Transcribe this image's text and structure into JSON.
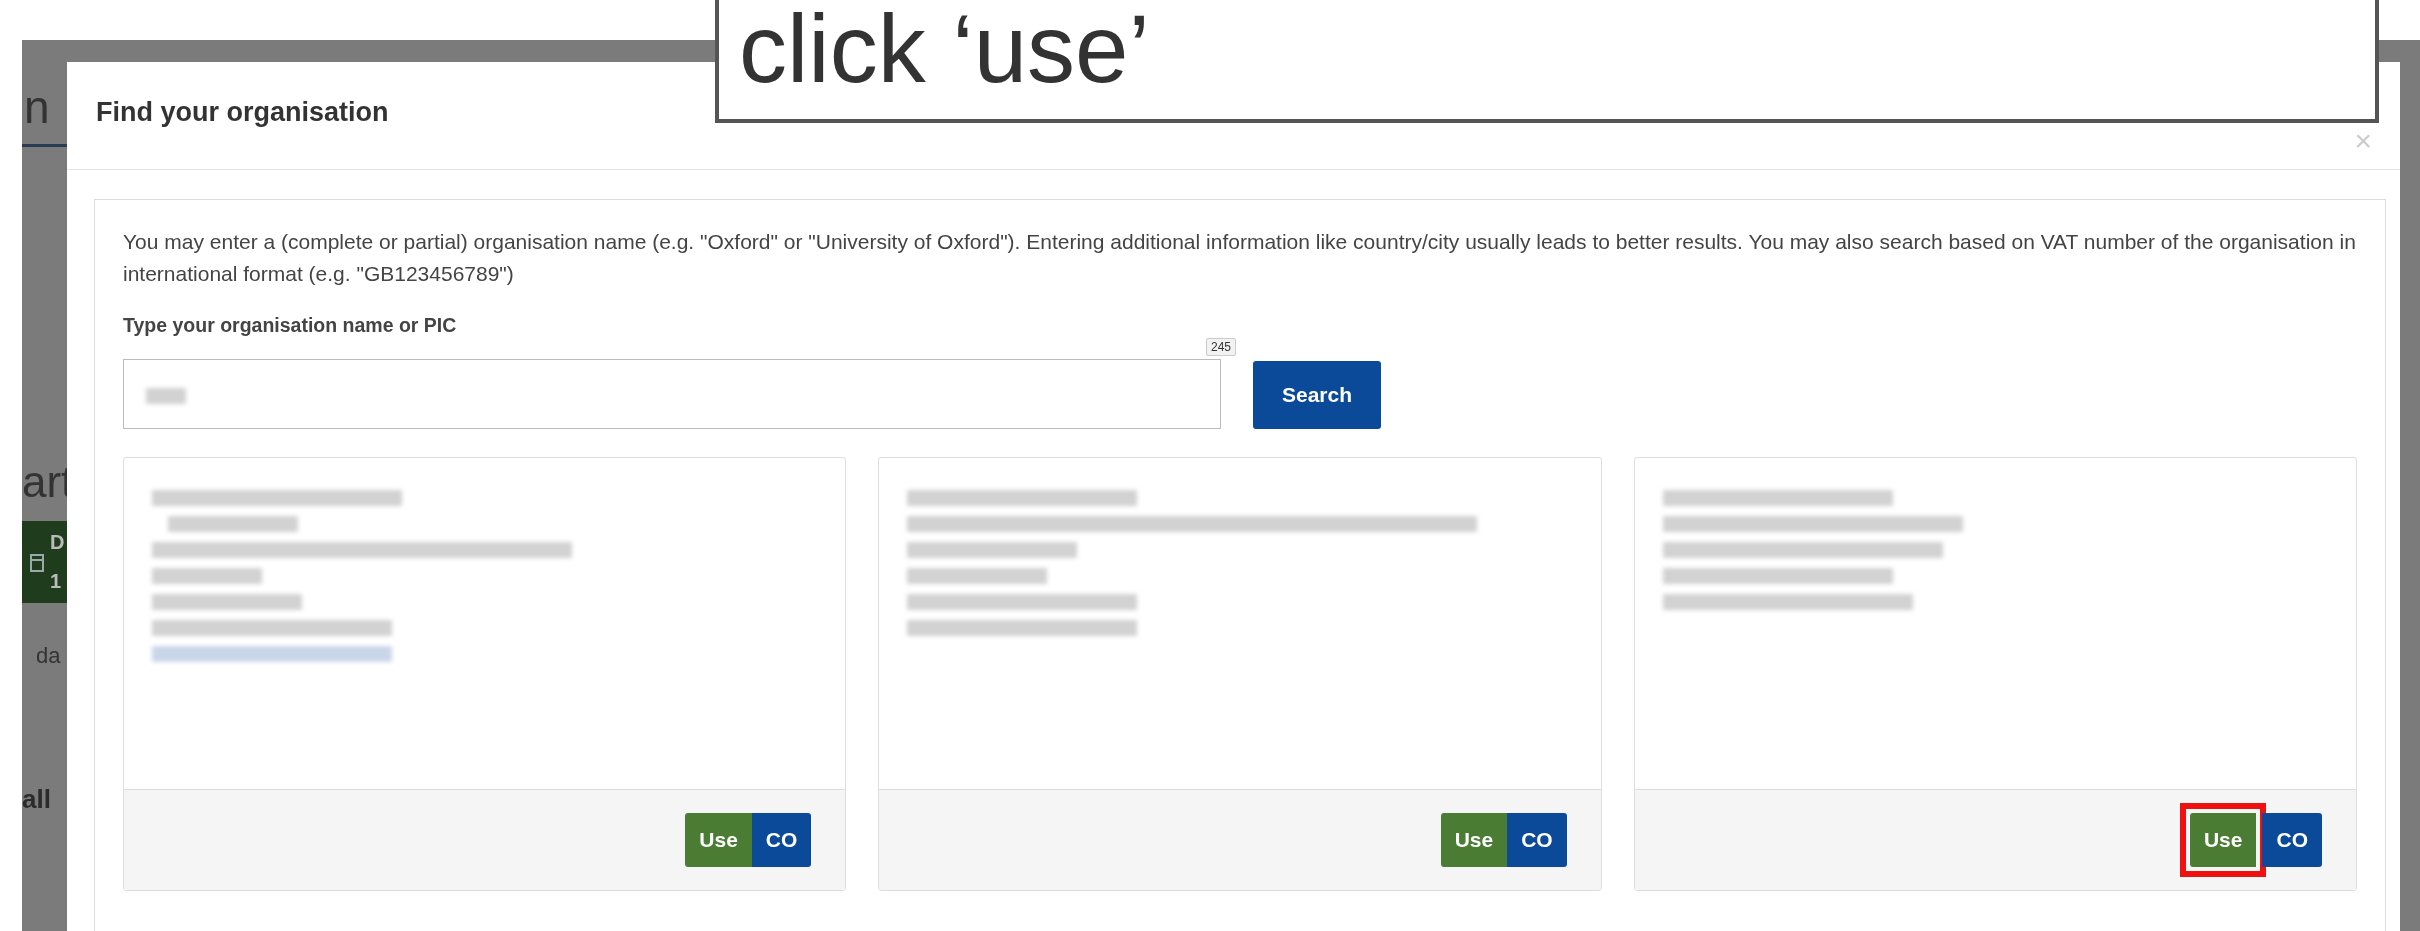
{
  "background_page": {
    "heading": "n",
    "subheading": "art",
    "tile": {
      "label": "D",
      "value": "1"
    },
    "note": "da",
    "link": "all"
  },
  "dialog": {
    "title": "Find your organisation",
    "close": "×",
    "intro": "You may enter a (complete or partial) organisation name (e.g. \"Oxford\" or \"University of Oxford\"). Entering additional information like country/city usually leads to better results. You may also search based on VAT number of the organisation in international format (e.g. \"GB123456789\")",
    "field_label": "Type your organisation name or PIC",
    "counter": "245",
    "search_button": "Search",
    "results": [
      {
        "use_label": "Use",
        "co_label": "CO",
        "highlighted": false
      },
      {
        "use_label": "Use",
        "co_label": "CO",
        "highlighted": false
      },
      {
        "use_label": "Use",
        "co_label": "CO",
        "highlighted": true
      }
    ]
  },
  "callout": {
    "text": "click ‘use’"
  }
}
